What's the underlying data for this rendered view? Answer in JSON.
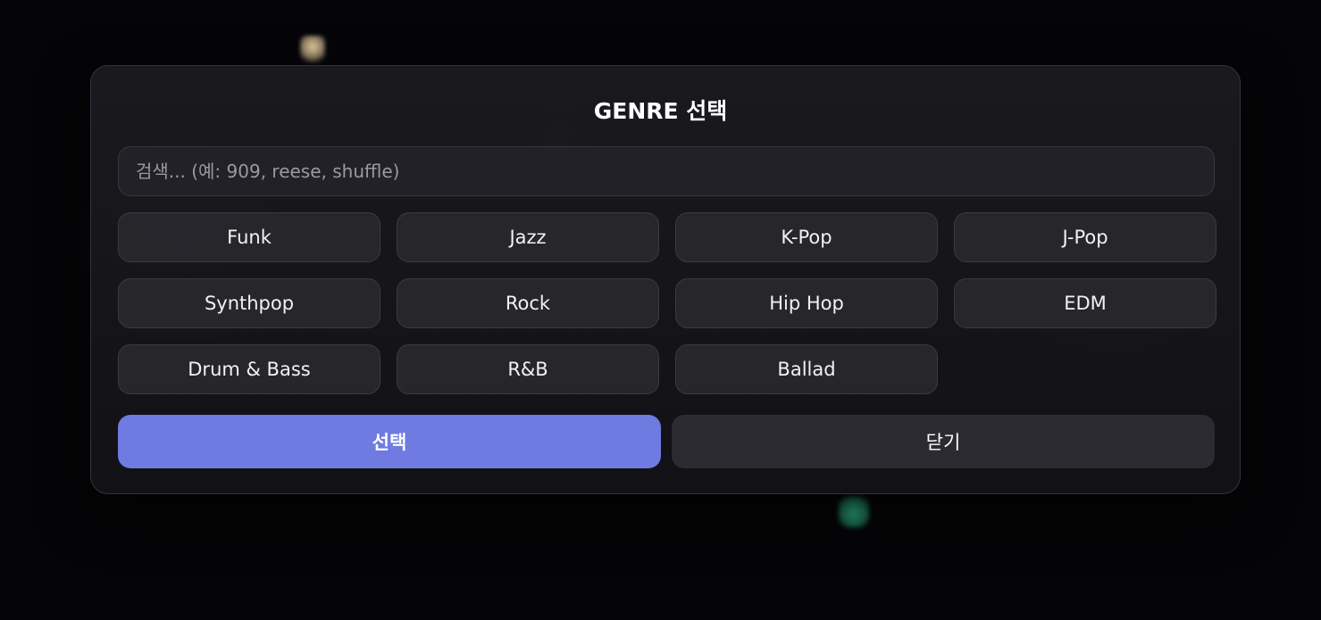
{
  "modal": {
    "title": "GENRE 선택",
    "search_placeholder": "검색... (예: 909, reese, shuffle)",
    "search_value": ""
  },
  "genres": [
    "Funk",
    "Jazz",
    "K-Pop",
    "J-Pop",
    "Synthpop",
    "Rock",
    "Hip Hop",
    "EDM",
    "Drum & Bass",
    "R&B",
    "Ballad"
  ],
  "actions": {
    "select_label": "선택",
    "close_label": "닫기"
  },
  "colors": {
    "accent": "#6f7be0",
    "modal_bg": "#1a1a1f",
    "button_bg": "#2b2b31"
  }
}
